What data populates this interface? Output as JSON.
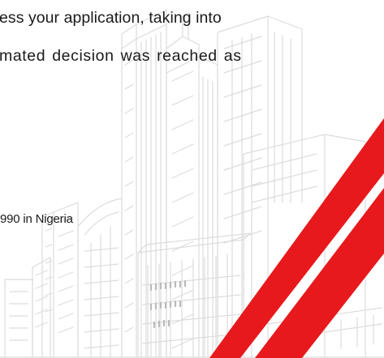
{
  "document": {
    "lines": [
      "ess your application, taking into",
      "mated decision was reached as",
      "990 in Nigeria"
    ]
  },
  "decoration": {
    "stripe_color": "#e8191c",
    "watermark_line_color": "#dcdcdc",
    "watermark_subject": "city skyline building sketch"
  }
}
